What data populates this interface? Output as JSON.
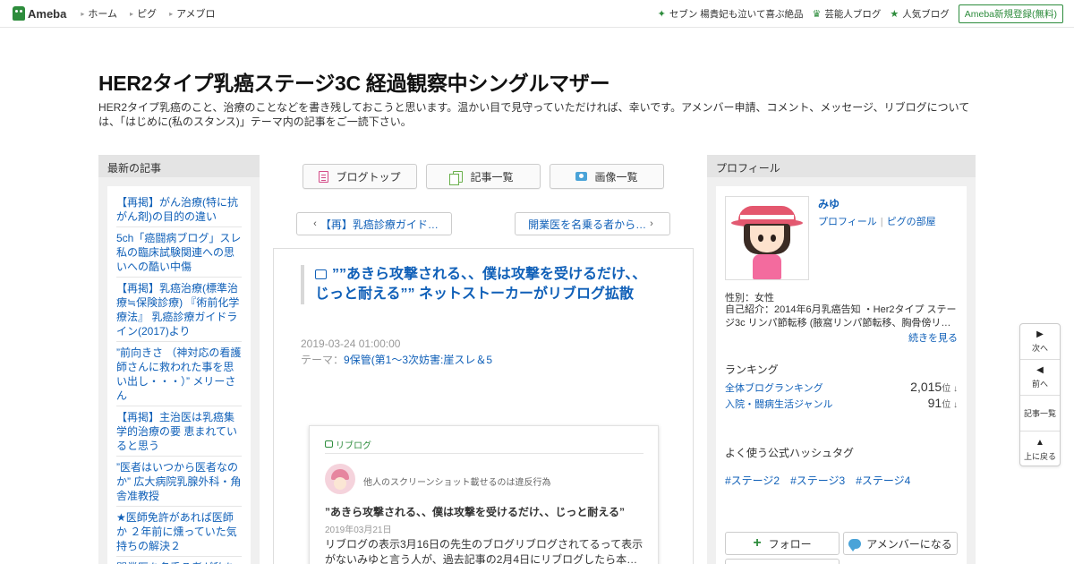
{
  "topbar": {
    "logo": "Ameba",
    "nav": [
      "ホーム",
      "ピグ",
      "アメブロ"
    ],
    "right": [
      {
        "icon": "sparkle-icon",
        "label": "セブン 楊貴妃も泣いて喜ぶ絶品"
      },
      {
        "icon": "crown-icon",
        "label": "芸能人ブログ"
      },
      {
        "icon": "star-icon",
        "label": "人気ブログ"
      }
    ],
    "register": "Ameba新規登録(無料)"
  },
  "header": {
    "title": "HER2タイプ乳癌ステージ3C 経過観察中シングルマザー",
    "description": "HER2タイプ乳癌のこと、治療のことなどを書き残しておこうと思います。温かい目で見守っていただければ、幸いです。アメンバー申請、コメント、メッセージ、リブログについては、「はじめに(私のスタンス)」テーマ内の記事をご一読下さい。"
  },
  "left": {
    "heading": "最新の記事",
    "items": [
      "【再掲】がん治療(特に抗がん剤)の目的の違い",
      "5ch「癌闘病ブログ」スレ私の臨床試験関連への思いへの酷い中傷",
      "【再掲】乳癌治療(標準治療≒保険診療) 『術前化学療法』 乳癌診療ガイドライン(2017)より",
      "”前向きさ （神対応の看護師さんに救われた事を思い出し・・・）” メリーさん",
      "【再掲】主治医は乳癌集学的治療の要 恵まれていると思う",
      "”医者はいつから医者なのか” 広大病院乳腺外科・角舎准教授",
      "★医師免許があれば医師か ２年前に燻っていた気持ちの解決２",
      "開業医を名乗る者が私を"
    ]
  },
  "center": {
    "nav_buttons": [
      {
        "icon": "blog-top-icon",
        "label": "ブログトップ"
      },
      {
        "icon": "article-list-icon",
        "label": "記事一覧"
      },
      {
        "icon": "image-list-icon",
        "label": "画像一覧"
      }
    ],
    "prev_label": "【再】乳癌診療ガイド…",
    "next_label": "開業医を名乗る者から…",
    "article": {
      "title": "””あきら攻撃される、、僕は攻撃を受けるだけ、、じっと耐える”” ネットストーカーがリブログ拡散",
      "date": "2019-03-24 01:00:00",
      "theme_prefix": "テーマ：",
      "theme": "9保管(第1～3次妨害:崖スレ＆5",
      "reblog": {
        "label": "リブログ",
        "user": "他人のスクリーンショット載せるのは違反行為",
        "title": "”あきら攻撃される、、僕は攻撃を受けるだけ、、じっと耐える”",
        "date": "2019年03月21日",
        "body": "リブログの表示3月16日の先生のブログリブログされてるって表示がないみゆと言う人が、過去記事の2月4日にリブログしたら本…"
      }
    }
  },
  "right": {
    "heading": "プロフィール",
    "name": "みゆ",
    "link_profile": "プロフィール",
    "link_separator": "|",
    "link_pigu": "ピグの部屋",
    "gender": "性別：女性",
    "intro": "自己紹介：2014年6月乳癌告知 ・Her2タイプ ステージ3c リンパ節転移 (腋窩リンパ節転移、胸骨傍リ…",
    "more": "続きを見る",
    "ranking_heading": "ランキング",
    "rankings": [
      {
        "label": "全体ブログランキング",
        "value": "2,015",
        "unit": "位 ↓"
      },
      {
        "label": "入院・闘病生活ジャンル",
        "value": "91",
        "unit": "位 ↓"
      }
    ],
    "hashtag_heading": "よく使う公式ハッシュタグ",
    "hashtags": [
      "#ステージ2",
      "#ステージ3",
      "#ステージ4"
    ],
    "follow": "フォロー",
    "amember": "アメンバーになる"
  },
  "float_nav": [
    {
      "arrow": "▶",
      "label": "次へ"
    },
    {
      "arrow": "◀",
      "label": "前へ"
    },
    {
      "arrow": "",
      "label": "記事一覧"
    },
    {
      "arrow": "▲",
      "label": "上に戻る"
    }
  ]
}
